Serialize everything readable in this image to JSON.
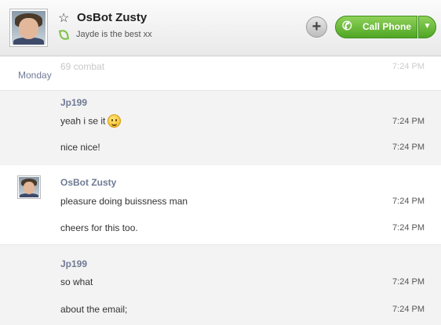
{
  "contact": {
    "name": "OsBot Zusty",
    "mood": "Jayde is the best xx"
  },
  "header": {
    "add_label": "+",
    "call_label": "Call Phone",
    "call_icon": "phone-icon",
    "dropdown_icon": "chevron-down-icon"
  },
  "conversation": {
    "day": "Monday",
    "faded_message": {
      "text": "69 combat",
      "time": "7:24 PM"
    },
    "groups": [
      {
        "sender": "Jp199",
        "messages": [
          {
            "text": "yeah i se it",
            "time": "7:24 PM",
            "emoticon": "smiley-icon"
          },
          {
            "text": "nice nice!",
            "time": "7:24 PM"
          }
        ]
      },
      {
        "sender": "OsBot Zusty",
        "messages": [
          {
            "text": "pleasure doing buissness man",
            "time": "7:24 PM"
          },
          {
            "text": "cheers for this too.",
            "time": "7:24 PM"
          }
        ]
      },
      {
        "sender": "Jp199",
        "messages": [
          {
            "text": "so what",
            "time": "7:24 PM"
          },
          {
            "text": "about the email;",
            "time": "7:24 PM"
          }
        ]
      }
    ]
  },
  "colors": {
    "call_green": "#4fa624",
    "sender_blue": "#6f7a94",
    "mood_green": "#7ac142"
  }
}
